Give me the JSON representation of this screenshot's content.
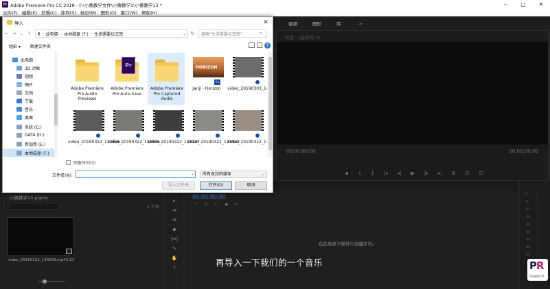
{
  "app": {
    "title": "Adobe Premiere Pro CC 2018 - F:\\小黄教学文件\\小黄教学1\\小黄教学13 *",
    "logo": "Pr",
    "menu": [
      "文件(F)",
      "编辑(E)",
      "剪辑(C)",
      "序列(S)",
      "标记(M)",
      "图形(G)",
      "窗口(W)",
      "帮助(H)"
    ],
    "workspaces": [
      "音频",
      "图形",
      "库"
    ],
    "workspaces_more": "»"
  },
  "program_monitor": {
    "label": "节目：(无序列) ≡",
    "timecode_left": "00;00;00;00",
    "timecode_right": "00;00;00;00",
    "transport": [
      "▪",
      "{",
      "}",
      "|◂",
      "◂|",
      "▶",
      "|▸",
      "▸|",
      "⊞",
      "⊟",
      "⊡"
    ]
  },
  "project_panel": {
    "title": "小黄教学13.prproj",
    "search_placeholder": "⌕",
    "count": "1 个项",
    "clip_name": "video_20190322_140209.mp4",
    "clip_duration": "5;23"
  },
  "tools": [
    "▸",
    "⇹",
    "⇔",
    "◆",
    "|↔|",
    "✎",
    "✋",
    "T"
  ],
  "timeline": {
    "timecode": "00;00;00;00",
    "tools": [
      "⌒",
      "∩",
      "⊂",
      "◆",
      "⌖"
    ],
    "drop_hint": "在此处放下媒体以创建序列。"
  },
  "meter_ticks": [
    "0",
    "-6",
    "-12",
    "-18",
    "-24",
    "-30",
    "-36",
    "-42",
    "-48",
    "-54"
  ],
  "subtitle": "再导入一下我们的一个音乐",
  "watermark": {
    "pr": "PR",
    "text": "ⓑ&prd.it"
  },
  "dialog": {
    "title": "导入",
    "close": "✕",
    "address_segments": [
      "此电脑",
      "本地磁盘 (F:)",
      "生活需要仪式感"
    ],
    "search_placeholder": "搜索\"生活需要仪式感\"",
    "toolbar": {
      "organize": "组织 ▾",
      "new_folder": "新建文件夹",
      "help": "?"
    },
    "nav_items": [
      {
        "label": "此电脑",
        "icon": "computer-icon",
        "color": "#4a90d9"
      },
      {
        "label": "3D 对象",
        "icon": "cube-icon",
        "color": "#6aa8e8"
      },
      {
        "label": "视频",
        "icon": "video-icon",
        "color": "#6a7fa8"
      },
      {
        "label": "图片",
        "icon": "picture-icon",
        "color": "#7fb3e6"
      },
      {
        "label": "文档",
        "icon": "document-icon",
        "color": "#9aa8bd"
      },
      {
        "label": "下载",
        "icon": "download-icon",
        "color": "#2f7fd0"
      },
      {
        "label": "音乐",
        "icon": "music-icon",
        "color": "#3d8be0"
      },
      {
        "label": "桌面",
        "icon": "desktop-icon",
        "color": "#4fa3e8"
      },
      {
        "label": "系统 (C:)",
        "icon": "drive-icon",
        "color": "#8aa0b8"
      },
      {
        "label": "DATA (D:)",
        "icon": "drive-icon",
        "color": "#8aa0b8"
      },
      {
        "label": "新加卷 (E:)",
        "icon": "drive-icon",
        "color": "#8aa0b8"
      },
      {
        "label": "本地磁盘 (F:)",
        "icon": "drive-icon",
        "color": "#8aa0b8"
      }
    ],
    "files": [
      {
        "name": "Adobe Premiere Pro Audio Previews",
        "kind": "folder"
      },
      {
        "name": "Adobe Premiere Pro Auto-Save",
        "kind": "pr-folder"
      },
      {
        "name": "Adobe Premiere Pro Captured Audio",
        "kind": "folder",
        "selected": true
      },
      {
        "name": "Janji - Horizon",
        "kind": "audio",
        "poster_text": "HORIZON"
      },
      {
        "name": "video_20190303_140018",
        "kind": "video",
        "tone": "#6c6c6c"
      },
      {
        "name": "video_20190322_132656",
        "kind": "video",
        "tone": "#5b5b5b"
      },
      {
        "name": "video_20190322_132936",
        "kind": "video",
        "tone": "#7a7a74"
      },
      {
        "name": "video_20190322_133127",
        "kind": "video",
        "tone": "#3d3d3d"
      },
      {
        "name": "video_20190322_133353",
        "kind": "video",
        "tone": "#8a8a86"
      },
      {
        "name": "video_20190322_134919",
        "kind": "video",
        "tone": "#9a8d84"
      },
      {
        "name": "",
        "kind": "video",
        "tone": "#4a4a48"
      },
      {
        "name": "",
        "kind": "video",
        "tone": "#a0a0a0"
      },
      {
        "name": "",
        "kind": "video",
        "tone": "#cfcfcf"
      },
      {
        "name": "",
        "kind": "video",
        "tone": "#b5b5b0"
      },
      {
        "name": "",
        "kind": "video",
        "tone": "#6e5f58"
      }
    ],
    "image_sequence_label": "图像序列(S)",
    "filename_label": "文件名(N):",
    "filename_value": "",
    "filter_value": "所有支持的媒体",
    "import_folder_button": "导入文件夹",
    "open_button": "打开(O)",
    "cancel_button": "取消"
  }
}
